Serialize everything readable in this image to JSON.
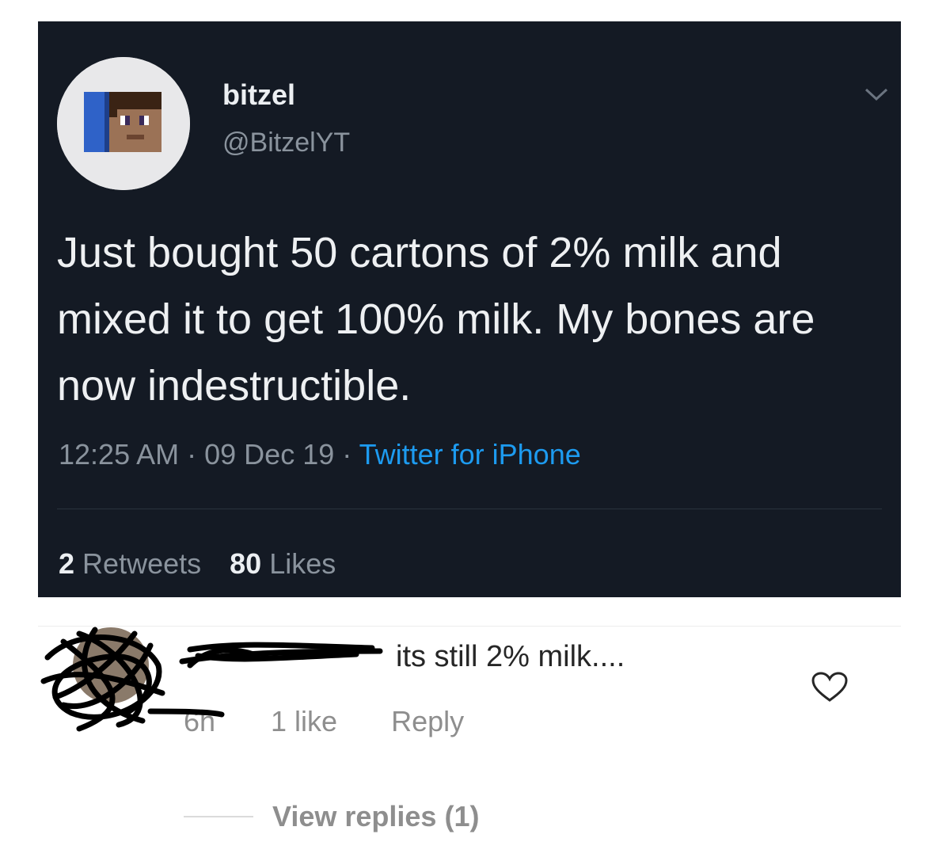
{
  "tweet": {
    "display_name": "bitzel",
    "handle": "@BitzelYT",
    "text": "Just bought 50 cartons of 2% milk and mixed it to get 100% milk. My bones are now indestructible.",
    "time": "12:25 AM",
    "date": "09 Dec 19",
    "separator": "·",
    "source": "Twitter for iPhone",
    "retweets_count": "2",
    "retweets_label": "Retweets",
    "likes_count": "80",
    "likes_label": "Likes",
    "menu_icon": "chevron-down-icon"
  },
  "comment": {
    "text": "its still 2% milk....",
    "time": "6h",
    "likes": "1 like",
    "reply_label": "Reply",
    "like_icon": "heart-icon",
    "view_replies": "View replies (1)"
  },
  "colors": {
    "tweet_background": "#141a24",
    "link_blue": "#1d9bf0",
    "muted_text": "#8a939d",
    "comment_muted": "#8e8e8e"
  }
}
